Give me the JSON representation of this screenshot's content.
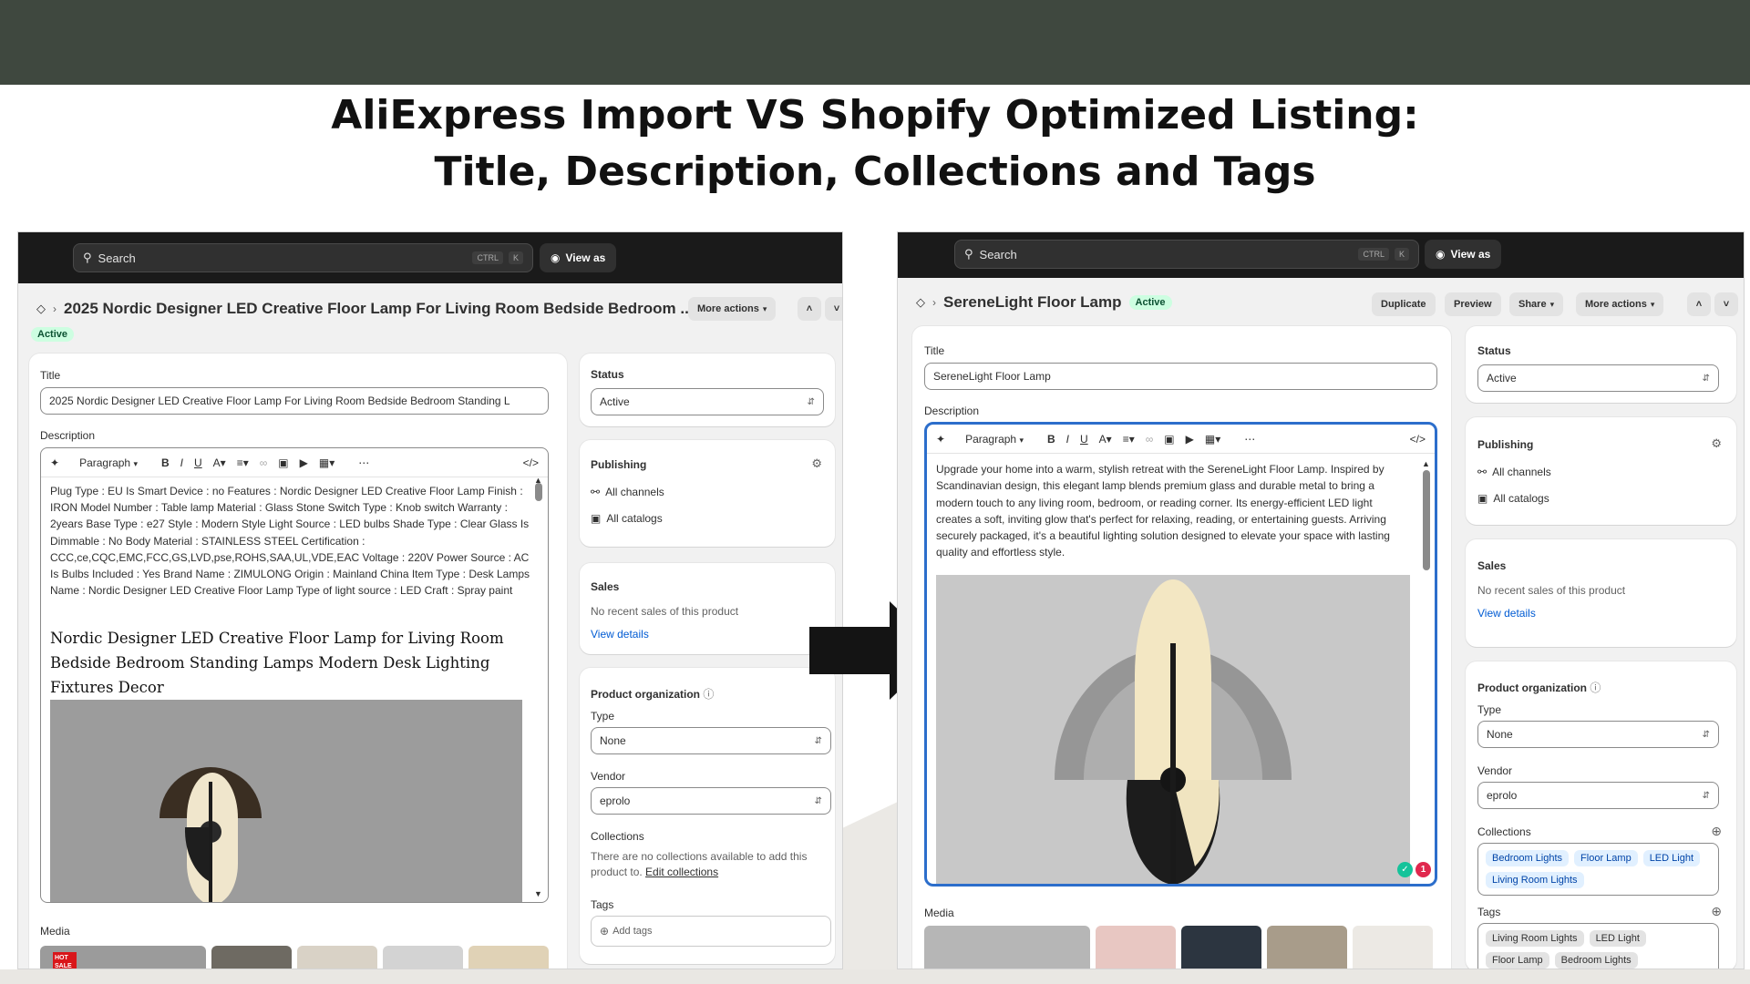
{
  "headline": {
    "line1": "AliExpress Import VS Shopify Optimized Listing:",
    "line2": "Title, Description, Collections and Tags"
  },
  "colors": {
    "top_band": "#3f483f",
    "active_badge": "#cdfee1",
    "link": "#005bd3",
    "chip_blue": "#e1f0ff",
    "editor_focus": "#2c6ecb"
  },
  "left": {
    "search": {
      "placeholder": "Search",
      "kbd_ctrl": "CTRL",
      "kbd_k": "K"
    },
    "view_as": "View as",
    "product_title": "2025 Nordic Designer LED Creative Floor Lamp For Living Room Bedside Bedroom ...",
    "status_badge": "Active",
    "more_actions": "More actions",
    "title_label": "Title",
    "title_value": "2025 Nordic Designer LED Creative Floor Lamp For Living Room Bedside Bedroom Standing L",
    "description_label": "Description",
    "toolbar_paragraph": "Paragraph",
    "description_specs": "Plug Type : EU Is Smart Device : no Features : Nordic Designer LED Creative Floor Lamp Finish : IRON Model Number : Table lamp Material : Glass Stone Switch Type : Knob switch Warranty : 2years Base Type : e27 Style : Modern Style Light Source : LED bulbs Shade Type : Clear Glass Is Dimmable : No Body Material : STAINLESS STEEL Certification : CCC,ce,CQC,EMC,FCC,GS,LVD,pse,ROHS,SAA,UL,VDE,EAC Voltage : 220V Power Source : AC Is Bulbs Included : Yes Brand Name : ZIMULONG Origin : Mainland China Item Type : Desk Lamps Name : Nordic Designer LED Creative Floor Lamp Type of light source : LED Craft : Spray paint",
    "description_heading": "Nordic Designer LED Creative Floor Lamp  for Living Room Bedside Bedroom Standing Lamps Modern Desk Lighting Fixtures Decor",
    "media_label": "Media",
    "thumb_badge": "HOT SALE",
    "status_label": "Status",
    "status_value": "Active",
    "publishing_label": "Publishing",
    "all_channels": "All channels",
    "all_catalogs": "All catalogs",
    "sales_label": "Sales",
    "sales_text": "No recent sales of this product",
    "view_details": "View details",
    "org_label": "Product organization",
    "type_label": "Type",
    "type_value": "None",
    "vendor_label": "Vendor",
    "vendor_value": "eprolo",
    "collections_label": "Collections",
    "collections_text": "There are no collections available to add this product to.",
    "edit_collections": "Edit collections",
    "tags_label": "Tags",
    "add_tags": "Add tags"
  },
  "right": {
    "search": {
      "placeholder": "Search",
      "kbd_ctrl": "CTRL",
      "kbd_k": "K"
    },
    "view_as": "View as",
    "product_title": "SereneLight Floor Lamp",
    "status_badge": "Active",
    "duplicate": "Duplicate",
    "preview": "Preview",
    "share": "Share",
    "more_actions": "More actions",
    "title_label": "Title",
    "title_value": "SereneLight Floor Lamp",
    "description_label": "Description",
    "toolbar_paragraph": "Paragraph",
    "description_text": "Upgrade your home into a warm, stylish retreat with the SereneLight Floor Lamp. Inspired by Scandinavian design, this elegant lamp blends premium glass and durable metal to bring a modern touch to any living room, bedroom, or reading corner. Its energy-efficient LED light creates a soft, inviting glow that's perfect for relaxing, reading, or entertaining guests. Arriving securely packaged, it's a beautiful lighting solution designed to elevate your space with lasting quality and effortless style.",
    "notif_count": "1",
    "media_label": "Media",
    "status_label": "Status",
    "status_value": "Active",
    "publishing_label": "Publishing",
    "all_channels": "All channels",
    "all_catalogs": "All catalogs",
    "sales_label": "Sales",
    "sales_text": "No recent sales of this product",
    "view_details": "View details",
    "org_label": "Product organization",
    "type_label": "Type",
    "type_value": "None",
    "vendor_label": "Vendor",
    "vendor_value": "eprolo",
    "collections_label": "Collections",
    "collections": [
      "Bedroom Lights",
      "Floor Lamp",
      "LED Light",
      "Living Room Lights"
    ],
    "tags_label": "Tags",
    "tags": [
      "Living Room Lights",
      "LED Light",
      "Floor Lamp",
      "Bedroom Lights"
    ]
  }
}
